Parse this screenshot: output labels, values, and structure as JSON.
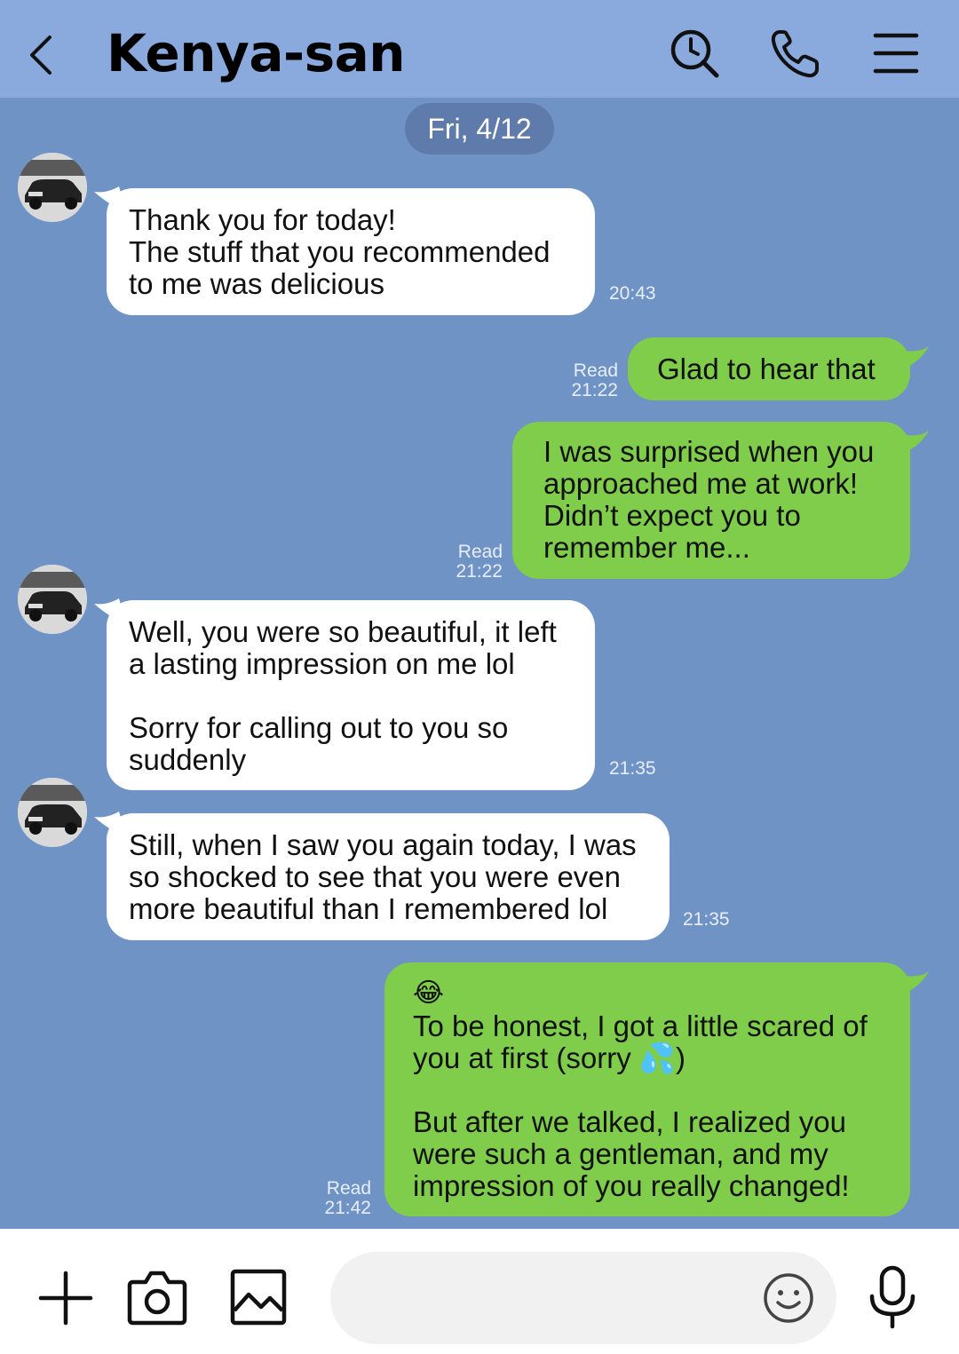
{
  "header": {
    "title": "Kenya-san",
    "icons": [
      "back-icon",
      "search-icon",
      "phone-icon",
      "menu-icon"
    ]
  },
  "date_separator": "Fri, 4/12",
  "messages": [
    {
      "from": "them",
      "text": "Thank you for today!\nThe stuff that you recommended\nto me was delicious",
      "time": "20:43"
    },
    {
      "from": "me",
      "text": "Glad to hear that",
      "read": "Read",
      "time": "21:22"
    },
    {
      "from": "me",
      "text": "I was surprised when you\napproached me at work!\nDidn’t expect you to\nremember me...",
      "read": "Read",
      "time": "21:22"
    },
    {
      "from": "them",
      "text": "Well, you were so beautiful, it left\na lasting impression on me lol\n\nSorry for calling out to you so\nsuddenly",
      "time": "21:35"
    },
    {
      "from": "them",
      "text": "Still, when I saw you again today, I was\nso shocked to see that you were even\nmore beautiful than I remembered lol",
      "time": "21:35"
    },
    {
      "from": "me",
      "emoji_line": "😂",
      "text_line1": "To be honest, I got a little scared of",
      "text_line2_a": "you at first (sorry ",
      "emoji_inline": "💦",
      "text_line2_b": ")",
      "text_rest": "\nBut after we talked, I realized you\nwere such a gentleman, and my\nimpression of you really changed!",
      "read": "Read",
      "time": "21:42"
    }
  ],
  "composer": {
    "placeholder": "",
    "icons": [
      "plus-icon",
      "camera-icon",
      "image-icon",
      "emoji-icon",
      "microphone-icon"
    ]
  },
  "colors": {
    "background": "#7093c6",
    "header": "#8aa9dd",
    "incoming_bubble": "#ffffff",
    "outgoing_bubble": "#7fcd4a"
  }
}
